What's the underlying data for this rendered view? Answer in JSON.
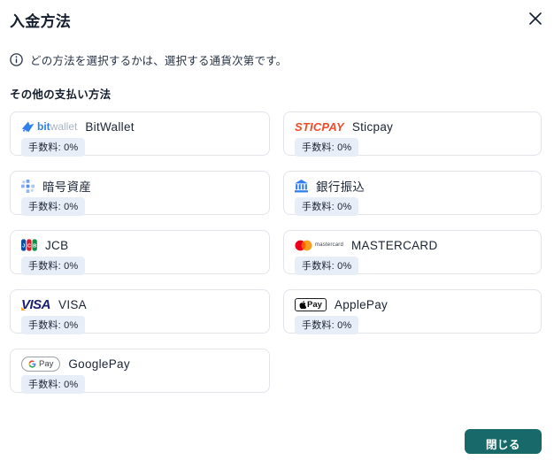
{
  "dialog": {
    "title": "入金方法",
    "info_text": "どの方法を選択するかは、選択する通貨次第です。",
    "section_title": "その他の支払い方法",
    "close_button_label": "閉じる"
  },
  "icons": {
    "close": "x-cross",
    "info": "circled-i"
  },
  "colors": {
    "accent_teal": "#176a69",
    "badge_bg": "#e8eef8",
    "text_dark": "#1a2433",
    "card_border": "#e2e4ea",
    "bitwallet_blue": "#2f80ed",
    "sticpay_orange": "#f04b26",
    "visa_navy": "#1a1f71",
    "mastercard_red": "#eb001b",
    "mastercard_orange": "#f79e1b",
    "bank_blue": "#2d7ff0"
  },
  "payment_methods": [
    {
      "name": "BitWallet",
      "fee": "手数料: 0%",
      "logo_bit": "bit",
      "logo_wallet": "wallet"
    },
    {
      "name": "Sticpay",
      "fee": "手数料: 0%",
      "logo_text": "STICPAY"
    },
    {
      "name": "暗号資産",
      "fee": "手数料: 0%"
    },
    {
      "name": "銀行振込",
      "fee": "手数料: 0%"
    },
    {
      "name": "JCB",
      "fee": "手数料: 0%"
    },
    {
      "name": "MASTERCARD",
      "fee": "手数料: 0%",
      "logo_text": "mastercard"
    },
    {
      "name": "VISA",
      "fee": "手数料: 0%",
      "logo_text": "VISA"
    },
    {
      "name": "ApplePay",
      "fee": "手数料: 0%",
      "logo_text": "Pay"
    },
    {
      "name": "GooglePay",
      "fee": "手数料: 0%",
      "logo_g": "G",
      "logo_pay": "Pay"
    }
  ]
}
